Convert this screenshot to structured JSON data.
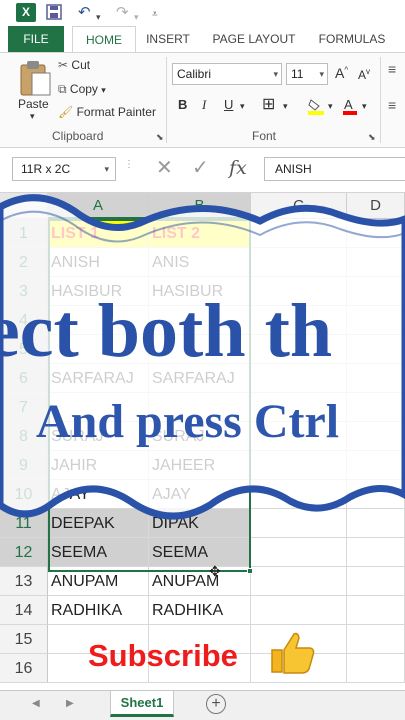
{
  "app": {
    "logo_letter": "X"
  },
  "quick_access": {
    "save_icon": "save-icon",
    "undo_icon": "undo-icon",
    "redo_icon": "redo-icon",
    "customize_icon": "customize-icon"
  },
  "ribbon_tabs": [
    "FILE",
    "HOME",
    "INSERT",
    "PAGE LAYOUT",
    "FORMULAS"
  ],
  "clipboard": {
    "paste_label": "Paste",
    "cut_label": "Cut",
    "copy_label": "Copy",
    "format_painter_label": "Format Painter",
    "group_label": "Clipboard"
  },
  "font": {
    "name": "Calibri",
    "size": "11",
    "group_label": "Font",
    "bold": "B",
    "italic": "I",
    "underline": "U"
  },
  "formula_bar": {
    "name_box": "11R x 2C",
    "fx": "fx",
    "value": "ANISH"
  },
  "columns": [
    "A",
    "B",
    "C",
    "D"
  ],
  "rows": [
    {
      "num": "1",
      "a": "LIST 1",
      "b": "LIST 2"
    },
    {
      "num": "2",
      "a": "ANISH",
      "b": "ANIS"
    },
    {
      "num": "3",
      "a": "HASIBUR",
      "b": "HASIBUR"
    },
    {
      "num": "4",
      "a": "",
      "b": ""
    },
    {
      "num": "5",
      "a": "",
      "b": ""
    },
    {
      "num": "6",
      "a": "SARFARAJ",
      "b": "SARFARAJ"
    },
    {
      "num": "7",
      "a": "",
      "b": ""
    },
    {
      "num": "8",
      "a": "SURAJ",
      "b": "SURAJ"
    },
    {
      "num": "9",
      "a": "JAHIR",
      "b": "JAHEER"
    },
    {
      "num": "10",
      "a": "AJAY",
      "b": "AJAY"
    },
    {
      "num": "11",
      "a": "DEEPAK",
      "b": "DIPAK"
    },
    {
      "num": "12",
      "a": "SEEMA",
      "b": "SEEMA"
    },
    {
      "num": "13",
      "a": "ANUPAM",
      "b": "ANUPAM"
    },
    {
      "num": "14",
      "a": "RADHIKA",
      "b": "RADHIKA"
    },
    {
      "num": "15",
      "a": "",
      "b": ""
    },
    {
      "num": "16",
      "a": "",
      "b": ""
    }
  ],
  "overlay": {
    "line1": "ect both th",
    "line2": "And press Ctrl",
    "subscribe": "Subscribe",
    "thumb_icon": "thumbs-up-icon"
  },
  "sheet_tabs": {
    "active": "Sheet1",
    "add": "+"
  },
  "colors": {
    "excel_green": "#217346",
    "header_fill": "#ffff00",
    "header_text": "#ff0000",
    "overlay_text": "#2a52a8",
    "subscribe": "#ee1c1c"
  }
}
